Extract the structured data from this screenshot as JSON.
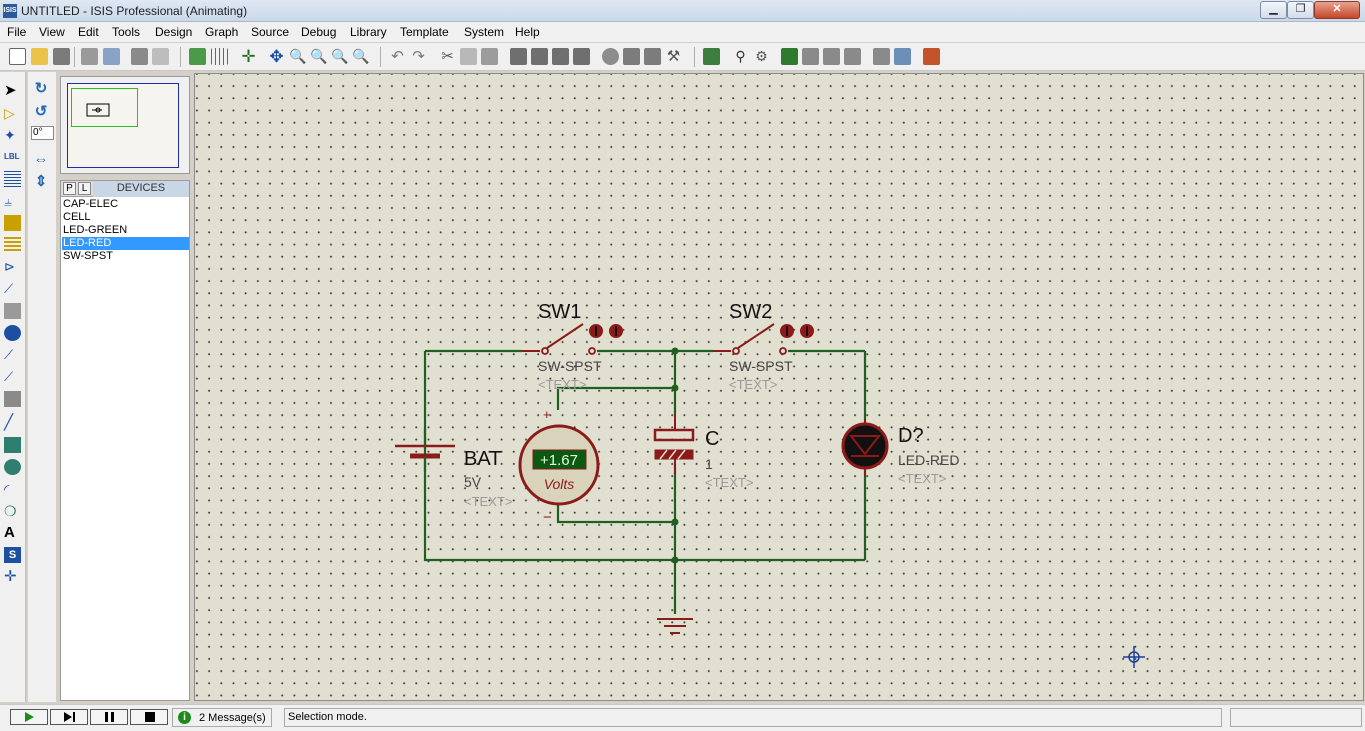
{
  "window": {
    "title": "UNTITLED - ISIS Professional (Animating)",
    "app_icon": "ISIS"
  },
  "menu": [
    "File",
    "Edit",
    "View",
    "Tools",
    "Design",
    "Graph",
    "Source",
    "Debug",
    "Library",
    "Template",
    "System",
    "Help"
  ],
  "rotation": {
    "angle": "0°"
  },
  "devices": {
    "tabs": [
      "P",
      "L"
    ],
    "title": "DEVICES",
    "items": [
      "CAP-ELEC",
      "CELL",
      "LED-GREEN",
      "LED-RED",
      "SW-SPST"
    ],
    "selected_index": 3
  },
  "schematic": {
    "sw1": {
      "ref": "SW1",
      "value": "SW-SPST",
      "text": "<TEXT>"
    },
    "sw2": {
      "ref": "SW2",
      "value": "SW-SPST",
      "text": "<TEXT>"
    },
    "bat": {
      "ref": "BAT",
      "value": "5V",
      "text": "<TEXT>"
    },
    "voltmeter": {
      "reading": "+1.67",
      "unit": "Volts",
      "plus": "+",
      "minus": "−"
    },
    "cap": {
      "ref": "C",
      "value": "1",
      "text": "<TEXT>"
    },
    "led": {
      "ref": "D?",
      "value": "LED-RED",
      "text": "<TEXT>"
    }
  },
  "status": {
    "messages": "2 Message(s)",
    "mode": "Selection mode."
  },
  "colors": {
    "wire": "#1f5f1f",
    "component": "#8b1a1a",
    "canvas": "#e1dfd0",
    "grid_dot": "#3f3f3f",
    "selection": "#3399ff"
  }
}
